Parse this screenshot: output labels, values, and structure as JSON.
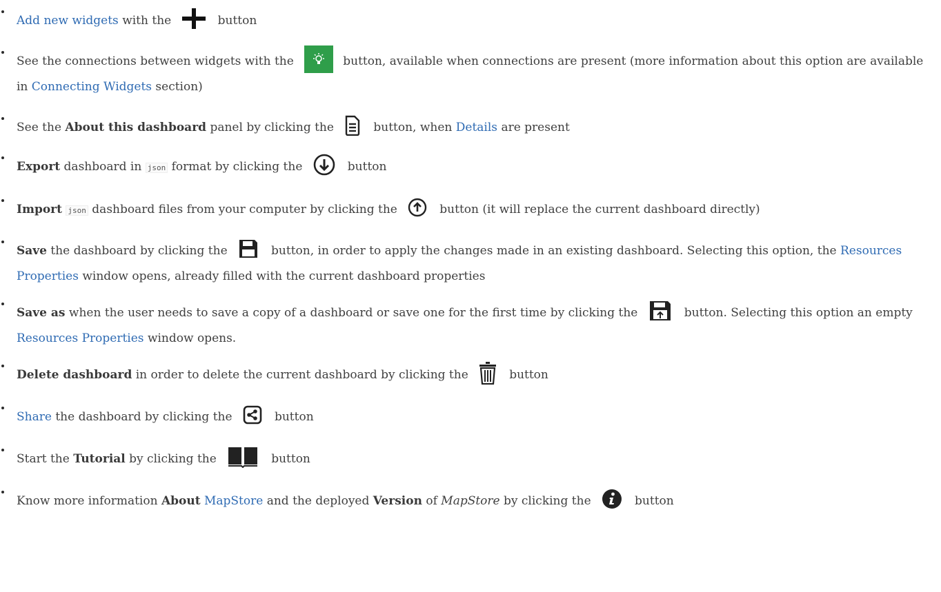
{
  "items": [
    {
      "link": "Add new widgets",
      "text_after": "with the",
      "text_end": "button",
      "icon": "plus-icon"
    },
    {
      "text_before": "See the connections between widgets with the",
      "text_after": "button, available when connections are present (more information about this option are available in",
      "link": "Connecting Widgets",
      "text_end": "section)",
      "icon": "lightbulb-icon",
      "button_color": "#2f9e4a"
    },
    {
      "text_before": "See the",
      "bold": "About this dashboard",
      "text_mid": "panel by clicking the",
      "text_after": "button, when",
      "link": "Details",
      "text_end": "are present",
      "icon": "document-icon"
    },
    {
      "bold": "Export",
      "text_before": "dashboard in",
      "code": "json",
      "text_mid": "format by clicking the",
      "text_end": "button",
      "icon": "download-circle-icon"
    },
    {
      "bold": "Import",
      "code": "json",
      "text_mid": "dashboard files from your computer by clicking the",
      "text_end": "button (it will replace the current dashboard directly)",
      "icon": "upload-circle-icon"
    },
    {
      "bold": "Save",
      "text_mid": "the dashboard by clicking the",
      "text_after": "button, in order to apply the changes made in an existing dashboard. Selecting this option, the",
      "link": "Resources Properties",
      "text_end": "window opens, already filled with the current dashboard properties",
      "icon": "save-icon"
    },
    {
      "bold": "Save as",
      "text_mid": "when the user needs to save a copy of a dashboard or save one for the first time by clicking the",
      "text_after": "button. Selecting this option an empty",
      "link": "Resources Properties",
      "text_end": "window opens.",
      "icon": "save-as-icon"
    },
    {
      "bold": "Delete dashboard",
      "text_mid": "in order to delete the current dashboard by clicking the",
      "text_end": "button",
      "icon": "trash-icon"
    },
    {
      "link": "Share",
      "text_mid": "the dashboard by clicking the",
      "text_end": "button",
      "icon": "share-icon"
    },
    {
      "text_before": "Start the",
      "bold": "Tutorial",
      "text_mid": "by clicking the",
      "text_end": "button",
      "icon": "book-icon"
    },
    {
      "text_before": "Know more information",
      "bold": "About",
      "link": "MapStore",
      "text_mid": "and the deployed",
      "bold2": "Version",
      "text_of": "of",
      "italic": "MapStore",
      "text_mid2": "by clicking the",
      "text_end": "button",
      "icon": "info-icon"
    }
  ],
  "colors": {
    "link": "#2f6bb3",
    "text": "#404040",
    "green_button": "#2f9e4a"
  }
}
